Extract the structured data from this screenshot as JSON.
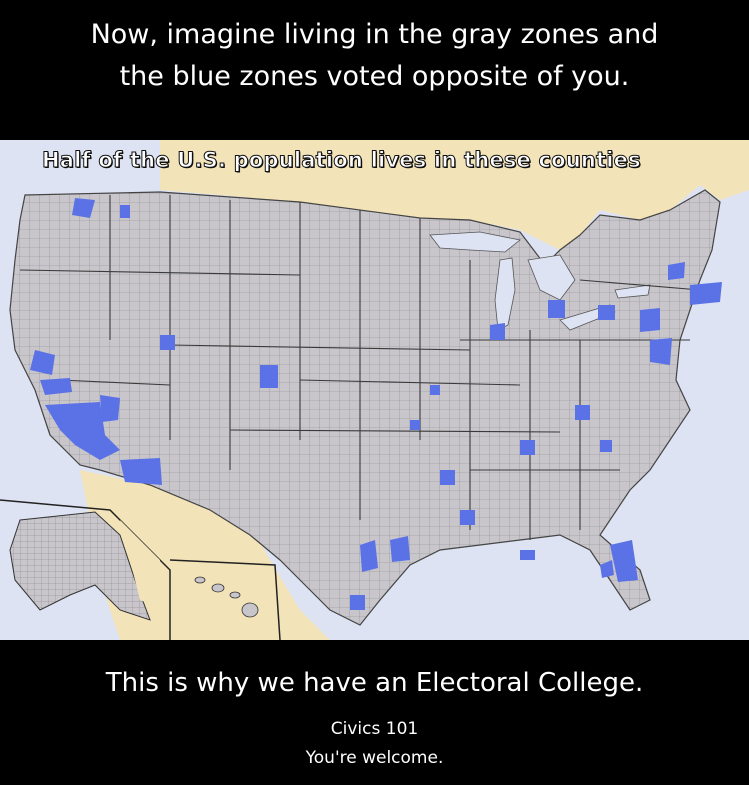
{
  "meme": {
    "top_line_1": "Now, imagine living in the gray zones and",
    "top_line_2": "the blue zones voted opposite of you.",
    "map_caption": "Half of the U.S. population lives in these counties",
    "bottom_line": "This is why we have an Electoral College.",
    "sub_line_1": "Civics 101",
    "sub_line_2": "You're welcome."
  },
  "map": {
    "land_color": "#c8c6cb",
    "blue_zone_color": "#5b72e6",
    "water_color": "#dde3f3",
    "neighbor_land_color": "#f3e3b8",
    "border_color": "#5a5a5a"
  }
}
